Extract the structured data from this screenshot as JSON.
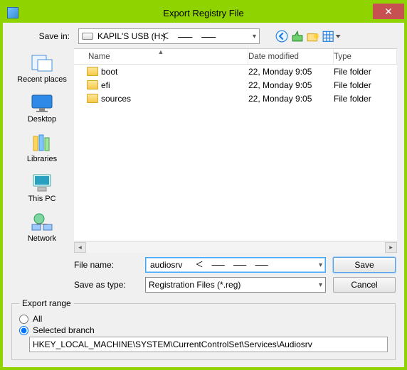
{
  "window": {
    "title": "Export Registry File"
  },
  "toolbar": {
    "save_in_label": "Save in:",
    "location": "KAPIL'S USB (H:)",
    "nav": {
      "back": "←",
      "up": "↑",
      "new_folder": "✶",
      "views": "▦",
      "views_arrow": "▾"
    }
  },
  "places": [
    {
      "id": "recent",
      "label": "Recent places"
    },
    {
      "id": "desktop",
      "label": "Desktop"
    },
    {
      "id": "libraries",
      "label": "Libraries"
    },
    {
      "id": "thispc",
      "label": "This PC"
    },
    {
      "id": "network",
      "label": "Network"
    }
  ],
  "columns": {
    "name": "Name",
    "date": "Date modified",
    "type": "Type"
  },
  "rows": [
    {
      "name": "boot",
      "date": "22, Monday 9:05",
      "type": "File folder"
    },
    {
      "name": "efi",
      "date": "22, Monday 9:05",
      "type": "File folder"
    },
    {
      "name": "sources",
      "date": "22, Monday 9:05",
      "type": "File folder"
    }
  ],
  "fields": {
    "file_name_label": "File name:",
    "file_name_value": "audiosrv",
    "save_as_type_label": "Save as type:",
    "save_as_type_value": "Registration Files (*.reg)"
  },
  "buttons": {
    "save": "Save",
    "cancel": "Cancel"
  },
  "export_range": {
    "legend": "Export range",
    "all_label": "All",
    "selected_branch_label": "Selected branch",
    "selected_branch_value": "HKEY_LOCAL_MACHINE\\SYSTEM\\CurrentControlSet\\Services\\Audiosrv",
    "selected": "selected_branch"
  }
}
